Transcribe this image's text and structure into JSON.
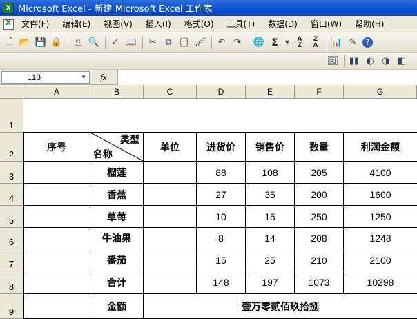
{
  "window": {
    "title": "Microsoft Excel - 新建 Microsoft Excel 工作表",
    "app_icon": "excel-icon"
  },
  "menu": [
    "文件(F)",
    "编辑(E)",
    "视图(V)",
    "插入(I)",
    "格式(O)",
    "工具(T)",
    "数据(D)",
    "窗口(W)",
    "帮助(H)"
  ],
  "formula_bar": {
    "name_box": "L13",
    "fx": "fx",
    "formula": ""
  },
  "columns": [
    "A",
    "B",
    "C",
    "D",
    "E",
    "F",
    "G"
  ],
  "rows": [
    "1",
    "2",
    "3",
    "4",
    "5",
    "6",
    "7",
    "8",
    "9"
  ],
  "sheet": {
    "header": {
      "serial": "序号",
      "diag_top": "类型",
      "diag_bottom": "名称",
      "unit": "单位",
      "purchase_price": "进货价",
      "sale_price": "销售价",
      "quantity": "数量",
      "profit": "利润金额"
    },
    "items": [
      {
        "name": "榴莲",
        "purchase": "88",
        "sale": "108",
        "qty": "205",
        "profit": "4100"
      },
      {
        "name": "香蕉",
        "purchase": "27",
        "sale": "35",
        "qty": "200",
        "profit": "1600"
      },
      {
        "name": "草莓",
        "purchase": "10",
        "sale": "15",
        "qty": "250",
        "profit": "1250"
      },
      {
        "name": "牛油果",
        "purchase": "8",
        "sale": "14",
        "qty": "208",
        "profit": "1248"
      },
      {
        "name": "番茄",
        "purchase": "15",
        "sale": "25",
        "qty": "210",
        "profit": "2100"
      }
    ],
    "total": {
      "label": "合计",
      "purchase": "148",
      "sale": "197",
      "qty": "1073",
      "profit": "10298"
    },
    "amount": {
      "label": "金额",
      "words": "壹万零贰佰玖拾捌"
    }
  }
}
